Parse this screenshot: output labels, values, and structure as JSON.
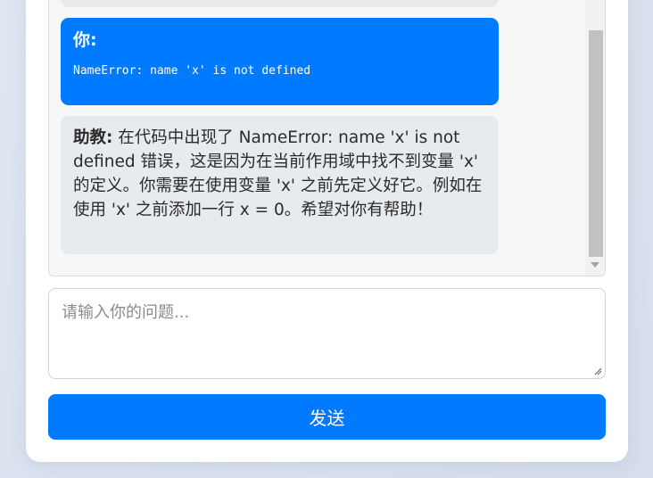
{
  "chat": {
    "messages": [
      {
        "role": "user",
        "speaker": "你:",
        "text": "NameError: name 'x' is not defined"
      },
      {
        "role": "assistant",
        "speaker": "助教:",
        "text": " 在代码中出现了 NameError: name 'x' is not defined 错误，这是因为在当前作用域中找不到变量 'x' 的定义。你需要在使用变量 'x' 之前先定义好它。例如在使用 'x' 之前添加一行 x = 0。希望对你有帮助！"
      }
    ]
  },
  "composer": {
    "placeholder": "请输入你的问题...",
    "value": ""
  },
  "send_button": {
    "label": "发送"
  },
  "colors": {
    "accent": "#007bff",
    "bot_bubble": "#e8ebee",
    "chat_background": "#f7f7f8"
  }
}
